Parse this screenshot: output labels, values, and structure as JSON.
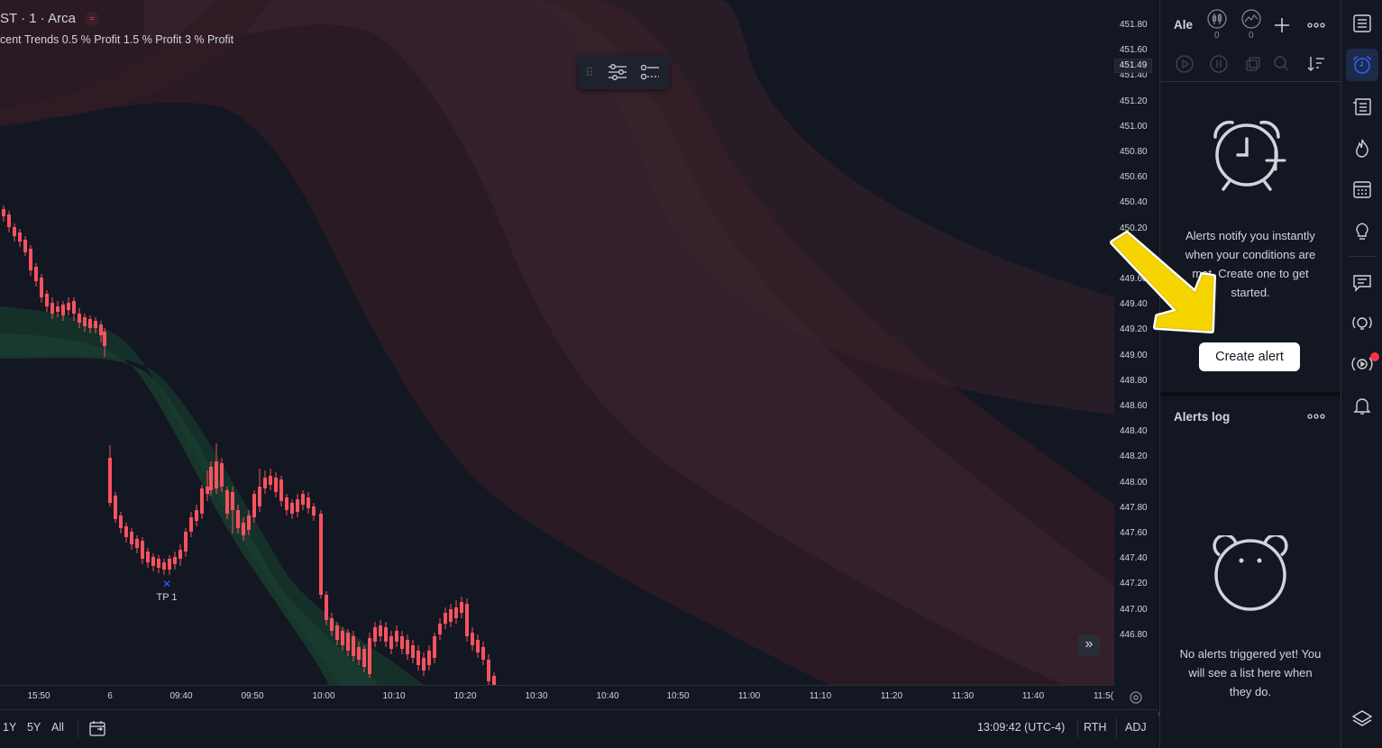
{
  "header": {
    "symbol_title": "ST · 1 · Arca",
    "indicator_legend": "cent Trends 0.5 % Profit 1.5 % Profit 3 % Profit"
  },
  "price_axis": {
    "ticks": [
      "451.80",
      "451.60",
      "451.40",
      "451.20",
      "451.00",
      "450.80",
      "450.60",
      "450.40",
      "450.20",
      "449.",
      "449.60",
      "449.40",
      "449.20",
      "449.00",
      "448.80",
      "448.60",
      "448.40",
      "448.20",
      "448.00",
      "447.80",
      "447.60",
      "447.40",
      "447.20",
      "447.00",
      "446.80"
    ],
    "current_price": "451.49"
  },
  "time_axis": {
    "ticks": [
      "15:50",
      "6",
      "09:40",
      "09:50",
      "10:00",
      "10:10",
      "10:20",
      "10:30",
      "10:40",
      "10:50",
      "11:00",
      "11:10",
      "11:20",
      "11:30",
      "11:40",
      "11:5("
    ]
  },
  "chart": {
    "trade_marker_label": "TP 1",
    "colors": {
      "up": "#26a69a",
      "down": "#f7525f",
      "background": "#131722"
    }
  },
  "bottom_bar": {
    "ranges": [
      "1Y",
      "5Y",
      "All"
    ],
    "clock": "13:09:42 (UTC-4)",
    "session": "RTH",
    "adjust": "ADJ"
  },
  "alerts_panel": {
    "title": "Ale",
    "price_alert_count": "0",
    "indicator_alert_count": "0",
    "empty_message": "Alerts notify you instantly when your conditions are met. Create one to get started.",
    "create_button": "Create alert"
  },
  "alerts_log": {
    "title": "Alerts log",
    "empty_message": "No alerts triggered yet! You will see a list here when they do."
  },
  "right_toolbar": {
    "icons": [
      "watchlist-icon",
      "alarm-clock-icon",
      "hotlist-icon",
      "flame-icon",
      "calendar-icon",
      "lightbulb-icon",
      "chat-icon",
      "ideas-stream-icon",
      "live-stream-icon",
      "notifications-bell-icon",
      "layers-icon"
    ]
  }
}
